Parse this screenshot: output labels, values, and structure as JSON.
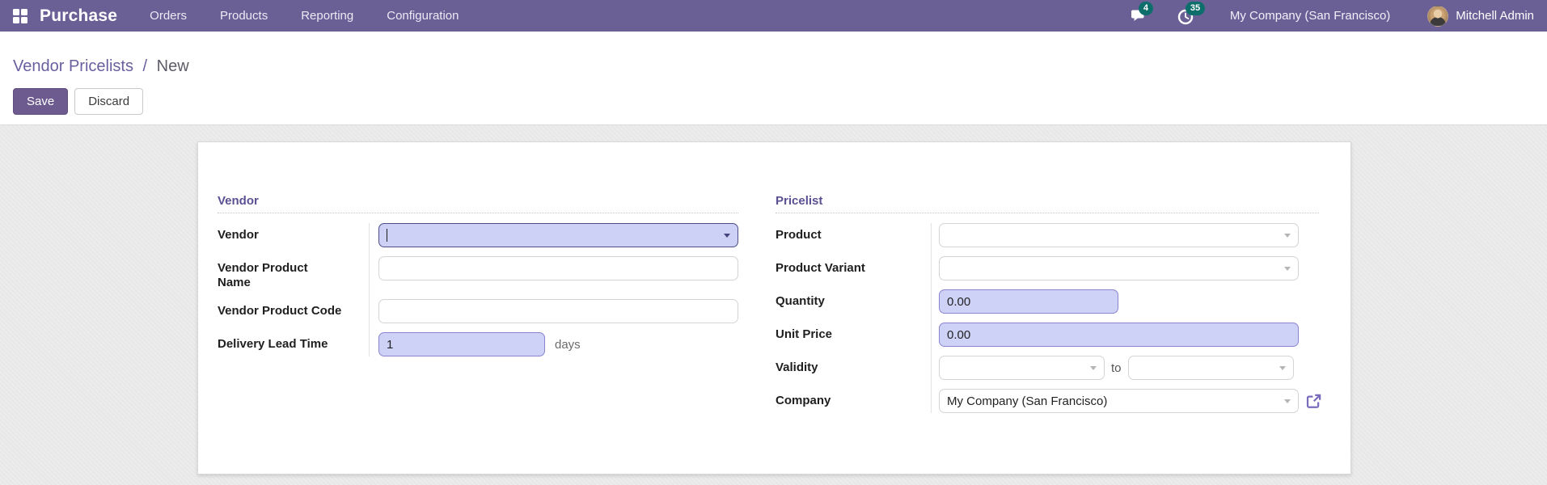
{
  "app": {
    "name": "Purchase",
    "menus": [
      "Orders",
      "Products",
      "Reporting",
      "Configuration"
    ]
  },
  "systray": {
    "messages_count": "4",
    "activities_count": "35",
    "company": "My Company (San Francisco)",
    "user": "Mitchell Admin"
  },
  "breadcrumb": {
    "parent": "Vendor Pricelists",
    "separator": "/",
    "current": "New"
  },
  "actions": {
    "save": "Save",
    "discard": "Discard"
  },
  "form": {
    "vendor_group": {
      "title": "Vendor",
      "fields": [
        {
          "label": "Vendor",
          "value": ""
        },
        {
          "label": "Vendor Product Name",
          "value": ""
        },
        {
          "label": "Vendor Product Code",
          "value": ""
        },
        {
          "label": "Delivery Lead Time",
          "value": "1",
          "suffix": "days"
        }
      ]
    },
    "pricelist_group": {
      "title": "Pricelist",
      "fields": [
        {
          "label": "Product",
          "value": ""
        },
        {
          "label": "Product Variant",
          "value": ""
        },
        {
          "label": "Quantity",
          "value": "0.00"
        },
        {
          "label": "Unit Price",
          "value": "0.00"
        },
        {
          "label": "Validity",
          "value_from": "",
          "to_label": "to",
          "value_to": ""
        },
        {
          "label": "Company",
          "value": "My Company (San Francisco)"
        }
      ]
    }
  },
  "colors": {
    "brand": "#6b6096",
    "badge": "#0d6e6c",
    "accent": "#6d5b90",
    "group_title": "#5a5193",
    "breadcrumb_link": "#6a5f9e",
    "field_highlight": "#ced2f7",
    "field_highlight_border": "#8a84d0",
    "focus_border": "#4f4d86",
    "link_icon": "#7a6bbd"
  }
}
